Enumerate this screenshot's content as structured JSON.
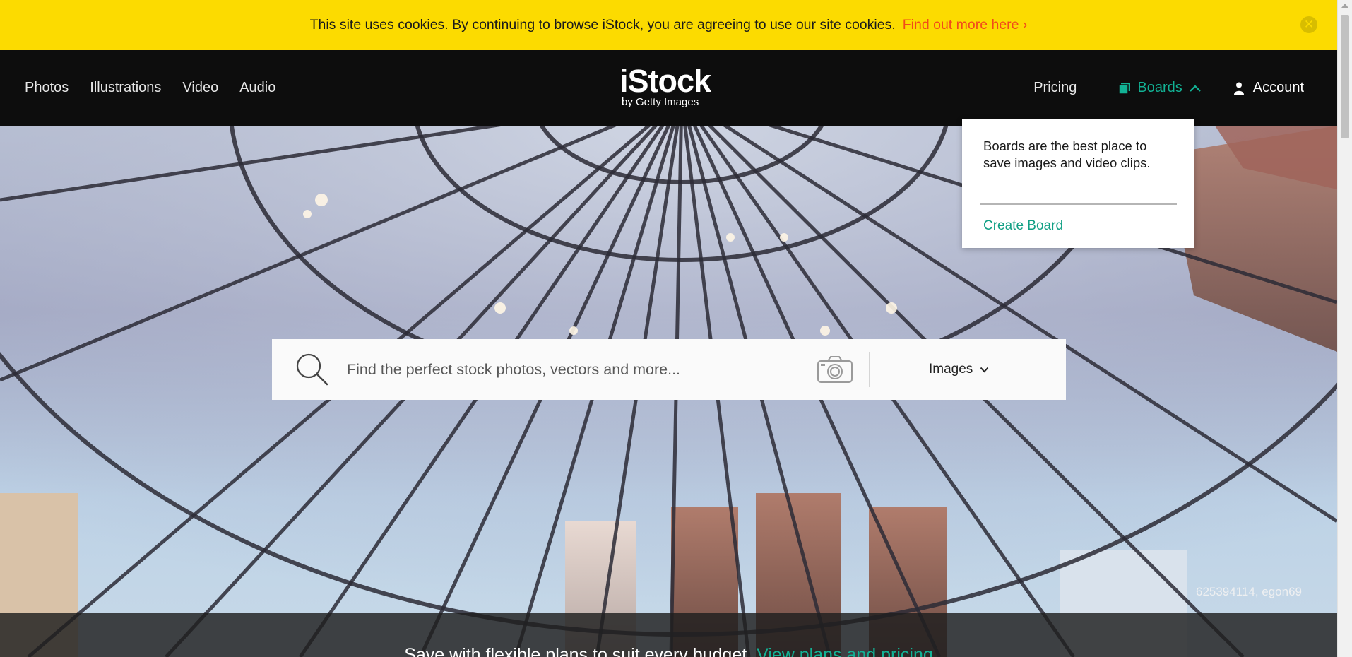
{
  "cookie_banner": {
    "message": "This site uses cookies. By continuing to browse iStock, you are agreeing to use our site cookies.",
    "link": "Find out more here ›",
    "close_icon": "close-icon"
  },
  "nav": {
    "left": [
      "Photos",
      "Illustrations",
      "Video",
      "Audio"
    ],
    "logo": {
      "brand": "iStock",
      "sub": "by Getty Images"
    },
    "pricing": "Pricing",
    "boards": "Boards",
    "boards_icon": "boards-icon",
    "account": "Account",
    "account_icon": "person-icon"
  },
  "boards_popup": {
    "text": "Boards are the best place to save images and video clips.",
    "create": "Create Board"
  },
  "search": {
    "placeholder": "Find the perfect stock photos, vectors and more...",
    "value": "",
    "media_type": "Images",
    "icons": [
      "search-icon",
      "camera-icon",
      "chevron-down-icon"
    ]
  },
  "hero": {
    "credit": "625394114, egon69"
  },
  "promo": {
    "text": "Save with flexible plans to suit every budget.",
    "link": "View plans and pricing"
  },
  "colors": {
    "banner": "#fcdb00",
    "banner_link": "#f24a1a",
    "accent": "#12b295",
    "nav_bg": "#0d0d0d"
  }
}
